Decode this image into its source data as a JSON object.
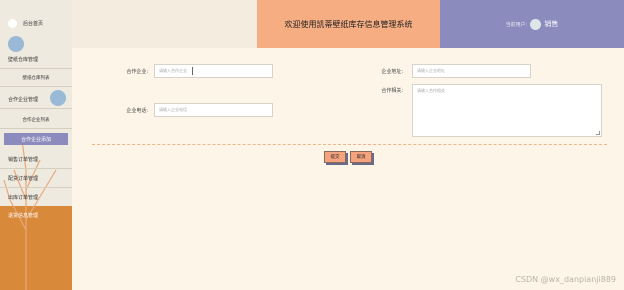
{
  "sidebar": {
    "items": [
      {
        "label": "后台首页"
      },
      {
        "label": "壁纸仓库管理"
      },
      {
        "label": "壁纸仓库列表"
      },
      {
        "label": "合作企业管理"
      },
      {
        "label": "合作企业列表"
      },
      {
        "label": "合作企业添加"
      },
      {
        "label": "销售订单管理"
      },
      {
        "label": "配货订单管理"
      },
      {
        "label": "出库订单管理"
      },
      {
        "label": "退货信息管理"
      }
    ]
  },
  "header": {
    "title": "欢迎使用凯蒂壁纸库存信息管理系统",
    "user_label": "当前用户:",
    "username": "销售"
  },
  "form": {
    "company_label": "合作企业:",
    "company_placeholder": "请输入合作企业",
    "phone_label": "企业电话:",
    "phone_placeholder": "请输入企业电话",
    "address_label": "企业地址:",
    "address_placeholder": "请输入企业地址",
    "info_label": "合作相关:",
    "info_placeholder": "请输入合作相关",
    "submit_label": "提交",
    "cancel_label": "取消"
  },
  "watermark": "CSDN @wx_danpianji889",
  "colors": {
    "title_bg": "#f7ad82",
    "user_bg": "#8b8bbd",
    "sidebar_bottom": "#d9893a",
    "page_bg": "#fdf5e8"
  }
}
